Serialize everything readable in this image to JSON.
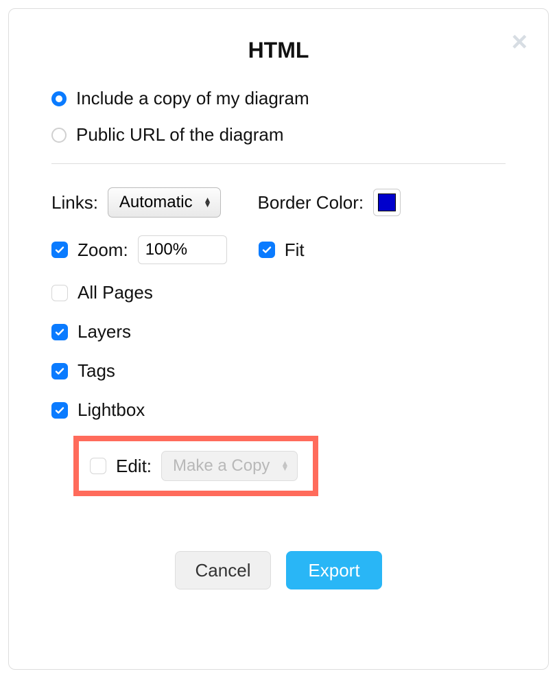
{
  "dialog": {
    "title": "HTML",
    "source": {
      "include_copy": "Include a copy of my diagram",
      "public_url": "Public URL of the diagram",
      "selected": "include_copy"
    },
    "links_label": "Links:",
    "links_value": "Automatic",
    "border_color_label": "Border Color:",
    "border_color": "#0000cc",
    "zoom_label": "Zoom:",
    "zoom_value": "100%",
    "zoom_checked": true,
    "fit_label": "Fit",
    "fit_checked": true,
    "all_pages_label": "All Pages",
    "all_pages_checked": false,
    "layers_label": "Layers",
    "layers_checked": true,
    "tags_label": "Tags",
    "tags_checked": true,
    "lightbox_label": "Lightbox",
    "lightbox_checked": true,
    "edit_label": "Edit:",
    "edit_checked": false,
    "edit_value": "Make a Copy",
    "cancel": "Cancel",
    "export": "Export"
  }
}
